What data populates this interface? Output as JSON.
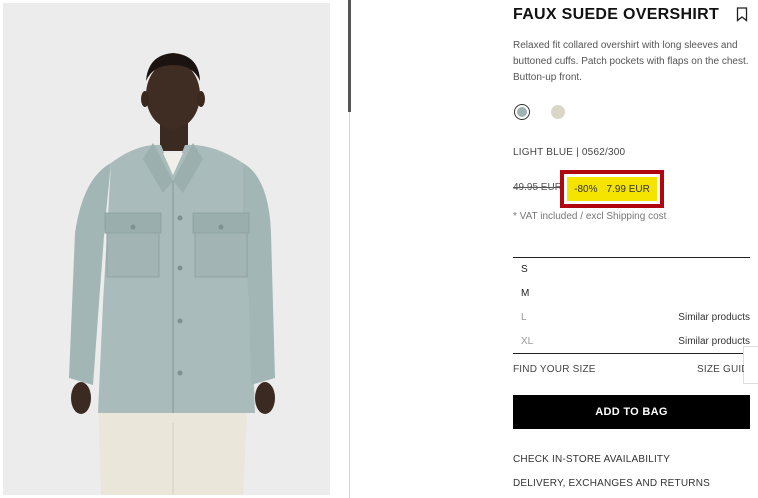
{
  "product": {
    "title": "FAUX SUEDE OVERSHIRT",
    "description": "Relaxed fit collared overshirt with long sleeves and buttoned cuffs. Patch pockets with flaps on the chest. Button-up front.",
    "color_code": "LIGHT BLUE | 0562/300",
    "old_price": "49.95 EUR",
    "discount": "-80%",
    "new_price": "7.99 EUR",
    "vat_note": "* VAT included / excl Shipping cost",
    "photo_icon": "product-photo-model"
  },
  "colors": {
    "selected": "#9fb1b1",
    "alternate": "#d9d6c7",
    "price_highlight": "#f5e400",
    "highlight_border": "#b00610",
    "button_bg": "#000000"
  },
  "sizes": [
    {
      "size": "S",
      "note": ""
    },
    {
      "size": "M",
      "note": ""
    },
    {
      "size": "L",
      "note": "Similar products"
    },
    {
      "size": "XL",
      "note": "Similar products"
    }
  ],
  "actions": {
    "find_size": "FIND YOUR SIZE",
    "size_guide": "SIZE GUIDE",
    "add_to_bag": "ADD TO BAG",
    "check_store": "CHECK IN-STORE AVAILABILITY",
    "delivery": "DELIVERY, EXCHANGES AND RETURNS"
  }
}
